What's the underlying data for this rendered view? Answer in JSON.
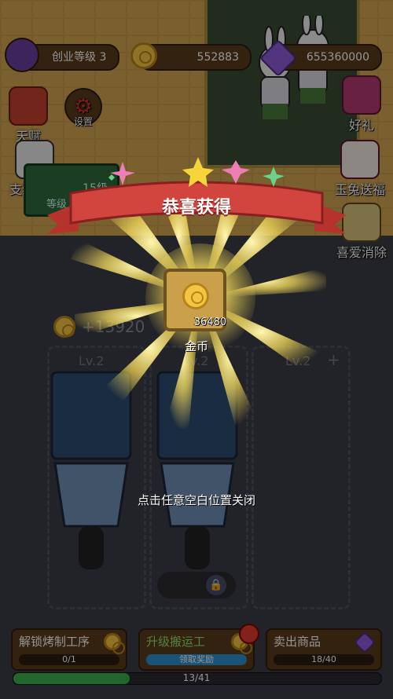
{
  "hud": {
    "level_label": "创业等级 3",
    "coins": "552883",
    "gems": "655360000"
  },
  "side_left": {
    "talent": "天赋",
    "settings": "设置",
    "branch_workshop": "支线车间",
    "branch_level": "15级",
    "branch_sub": "等级"
  },
  "side_right": {
    "gift": "好礼",
    "rabbit_gift": "玉兔送福",
    "match": "喜爱消除"
  },
  "income": "+13920",
  "carts": [
    {
      "level": "Lv.2"
    },
    {
      "level": "Lv.2"
    },
    {
      "level": "Lv.2"
    }
  ],
  "popup": {
    "title": "恭喜获得",
    "reward_count": "36480",
    "reward_name": "金币",
    "close_hint": "点击任意空白位置关闭"
  },
  "tasks": [
    {
      "title": "解锁烤制工序",
      "progress": "0/1",
      "value": 0
    },
    {
      "title": "升级搬运工",
      "progress": "领取奖励",
      "value": 1
    },
    {
      "title": "卖出商品",
      "progress": "18/40",
      "value": 0.45
    }
  ],
  "main_progress": {
    "text": "13/41",
    "value": 0.317
  },
  "colors": {
    "ribbon": "#d2453e",
    "coin": "#f4c542",
    "progress": "#3bb04a"
  }
}
